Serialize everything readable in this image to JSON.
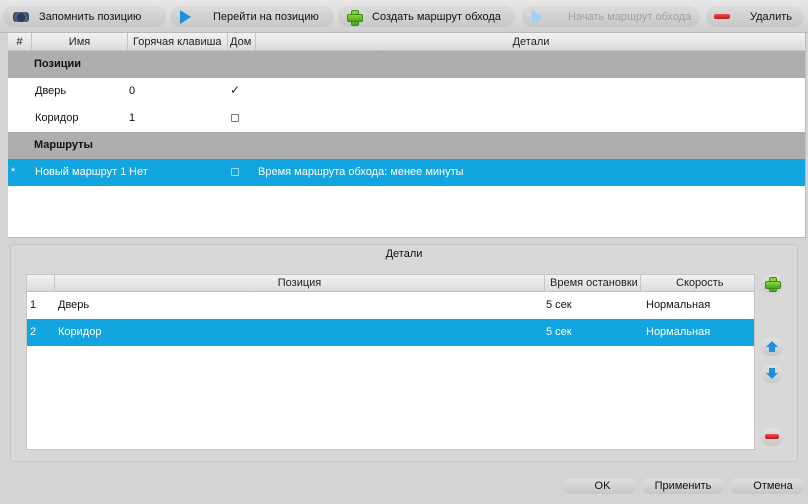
{
  "toolbar": {
    "remember_label": "Запомнить позицию",
    "goto_label": "Перейти на позицию",
    "create_route_label": "Создать маршрут обхода",
    "start_route_label": "Начать маршрут обхода",
    "delete_label": "Удалить"
  },
  "table": {
    "columns": {
      "num": "#",
      "name": "Имя",
      "hotkey": "Горячая клавиша",
      "home": "Дом",
      "details": "Детали"
    },
    "groups": {
      "positions": "Позиции",
      "routes": "Маршруты"
    },
    "positions": [
      {
        "name": "Дверь",
        "hotkey": "0",
        "home": true
      },
      {
        "name": "Коридор",
        "hotkey": "1",
        "home": false
      }
    ],
    "routes": [
      {
        "marker": "*",
        "name": "Новый маршрут 1",
        "hotkey": "Нет",
        "home": false,
        "details": "Время маршрута обхода: менее минуты",
        "selected": true
      }
    ]
  },
  "details": {
    "title": "Детали",
    "columns": {
      "position": "Позиция",
      "stop_time": "Время остановки",
      "speed": "Скорость"
    },
    "rows": [
      {
        "num": "1",
        "position": "Дверь",
        "stop_time": "5 сек",
        "speed": "Нормальная",
        "selected": false
      },
      {
        "num": "2",
        "position": "Коридор",
        "stop_time": "5 сек",
        "speed": "Нормальная",
        "selected": true
      }
    ]
  },
  "footer": {
    "ok_label": "OK",
    "apply_label": "Применить",
    "cancel_label": "Отмена"
  },
  "colors": {
    "selection": "#12a5e0",
    "group_header": "#aeaeae",
    "accent_blue": "#1f8fe0",
    "add_green": "#4fa51e",
    "remove_red": "#c21818"
  }
}
